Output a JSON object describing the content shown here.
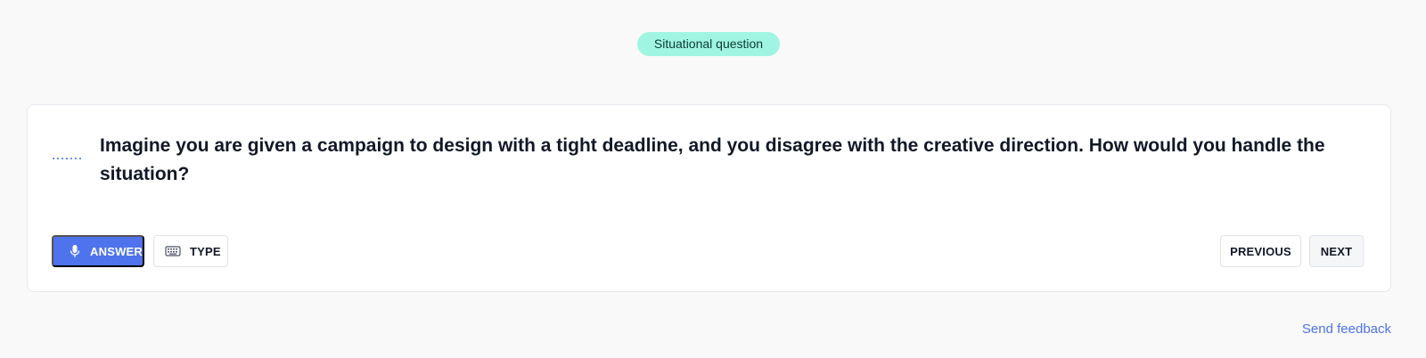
{
  "colors": {
    "page_background": "#f9f9f9",
    "badge_background": "#9ff5e2",
    "primary_accent": "#4e73ec",
    "text_primary": "#111827"
  },
  "badge": {
    "label": "Situational question"
  },
  "question": {
    "indicator_icon": "dotted-line-icon",
    "text": "Imagine you are given a campaign to design with a tight deadline, and you disagree with the creative direction. How would you handle the situation?"
  },
  "actions": {
    "answer": {
      "icon": "microphone-icon",
      "label": "ANSWER"
    },
    "type": {
      "icon": "keyboard-icon",
      "label": "TYPE"
    }
  },
  "navigation": {
    "previous_label": "PREVIOUS",
    "next_label": "NEXT"
  },
  "footer": {
    "feedback_link": "Send feedback"
  }
}
